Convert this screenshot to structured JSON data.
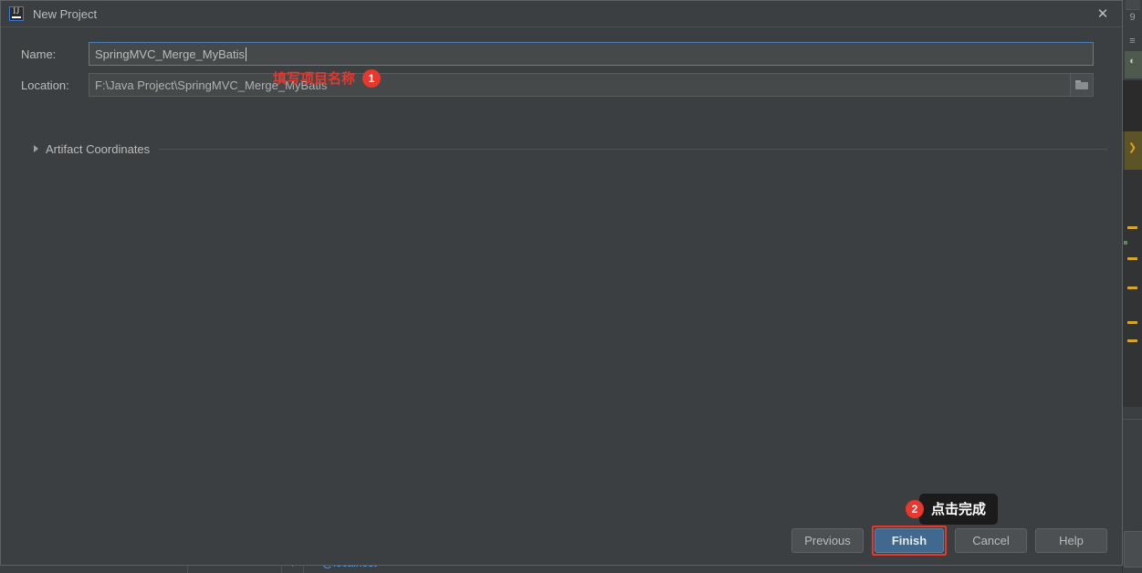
{
  "window": {
    "title": "New Project",
    "logo_icon": "intellij-idea-logo",
    "close_icon": "close-icon"
  },
  "form": {
    "name": {
      "label": "Name:",
      "value": "SpringMVC_Merge_MyBatis"
    },
    "location": {
      "label": "Location:",
      "value": "F:\\Java Project\\SpringMVC_Merge_MyBatis",
      "browse_icon": "folder-icon"
    },
    "artifact": {
      "label": "Artifact Coordinates",
      "expand_icon": "chevron-right-icon",
      "expanded": false
    }
  },
  "footer": {
    "previous_label": "Previous",
    "finish_label": "Finish",
    "cancel_label": "Cancel",
    "help_label": "Help"
  },
  "annotations": [
    {
      "badge": "1",
      "text": "填写项目名称",
      "color": "#e8372c"
    },
    {
      "badge": "2",
      "text": "点击完成",
      "color": "#e8372c",
      "tooltip_bg": "#1b1b1b"
    }
  ],
  "backdrop": {
    "status_connection": "@localhost",
    "plug_icon": "plug-icon",
    "grid_icon": "grid-icon",
    "caret_icon": "caret-down-icon"
  },
  "theme": {
    "dialog_bg": "#3c3f41",
    "field_bg": "#45494a",
    "accent_blue": "#41688f",
    "focus_border": "#4b7fb5",
    "text": "#bbbbbb",
    "annotation_red": "#e8372c"
  }
}
